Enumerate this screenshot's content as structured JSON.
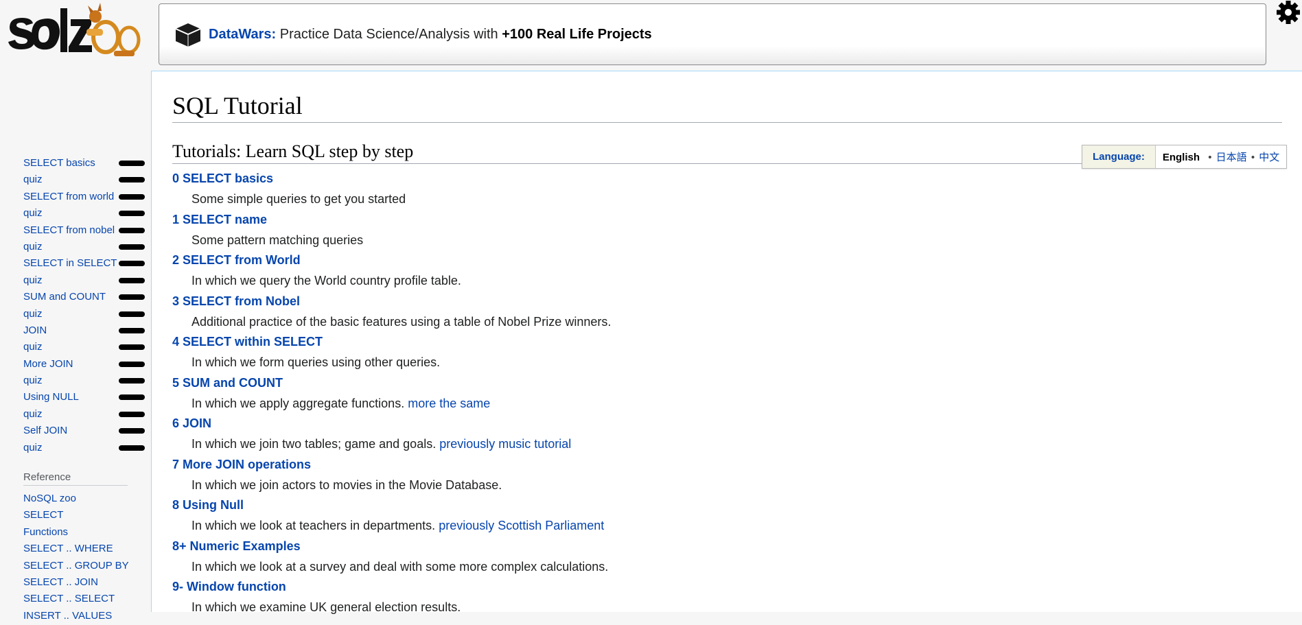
{
  "logo": {
    "text": "sqlzoo"
  },
  "banner": {
    "brand": "DataWars:",
    "text": "Practice Data Science/Analysis with",
    "highlight": "+100 Real Life Projects"
  },
  "page": {
    "title": "SQL Tutorial",
    "section_title": "Tutorials: Learn SQL step by step"
  },
  "language": {
    "label": "Language:",
    "current": "English",
    "sep": "•",
    "options": [
      "日本語",
      "中文"
    ]
  },
  "tutorials": [
    {
      "title": "0 SELECT basics",
      "desc": "Some simple queries to get you started",
      "extra": ""
    },
    {
      "title": "1 SELECT name",
      "desc": "Some pattern matching queries",
      "extra": ""
    },
    {
      "title": "2 SELECT from World",
      "desc": "In which we query the World country profile table.",
      "extra": ""
    },
    {
      "title": "3 SELECT from Nobel",
      "desc": "Additional practice of the basic features using a table of Nobel Prize winners.",
      "extra": ""
    },
    {
      "title": "4 SELECT within SELECT",
      "desc": "In which we form queries using other queries.",
      "extra": ""
    },
    {
      "title": "5 SUM and COUNT",
      "desc": "In which we apply aggregate functions.",
      "extra": "more the same"
    },
    {
      "title": "6 JOIN",
      "desc": "In which we join two tables; game and goals.",
      "extra": "previously music tutorial"
    },
    {
      "title": "7 More JOIN operations",
      "desc": "In which we join actors to movies in the Movie Database.",
      "extra": ""
    },
    {
      "title": "8 Using Null",
      "desc": "In which we look at teachers in departments.",
      "extra": "previously Scottish Parliament"
    },
    {
      "title": "8+ Numeric Examples",
      "desc": "In which we look at a survey and deal with some more complex calculations.",
      "extra": ""
    },
    {
      "title": "9- Window function",
      "desc": "In which we examine UK general election results.",
      "extra": ""
    }
  ],
  "sidebar": {
    "items": [
      "SELECT basics",
      "quiz",
      "SELECT from world",
      "quiz",
      "SELECT from nobel",
      "quiz",
      "SELECT in SELECT",
      "quiz",
      "SUM and COUNT",
      "quiz",
      "JOIN",
      "quiz",
      "More JOIN",
      "quiz",
      "Using NULL",
      "quiz",
      "Self JOIN",
      "quiz"
    ],
    "reference_heading": "Reference",
    "reference_items": [
      "NoSQL zoo",
      "SELECT",
      "Functions",
      "SELECT .. WHERE",
      "SELECT .. GROUP BY",
      "SELECT .. JOIN",
      "SELECT .. SELECT",
      "INSERT .. VALUES"
    ]
  },
  "icons": {
    "gear": "gear-icon",
    "datawars": "datawars-logo-icon"
  },
  "colors": {
    "link": "#0645ad",
    "accent": "#e8a33a"
  }
}
